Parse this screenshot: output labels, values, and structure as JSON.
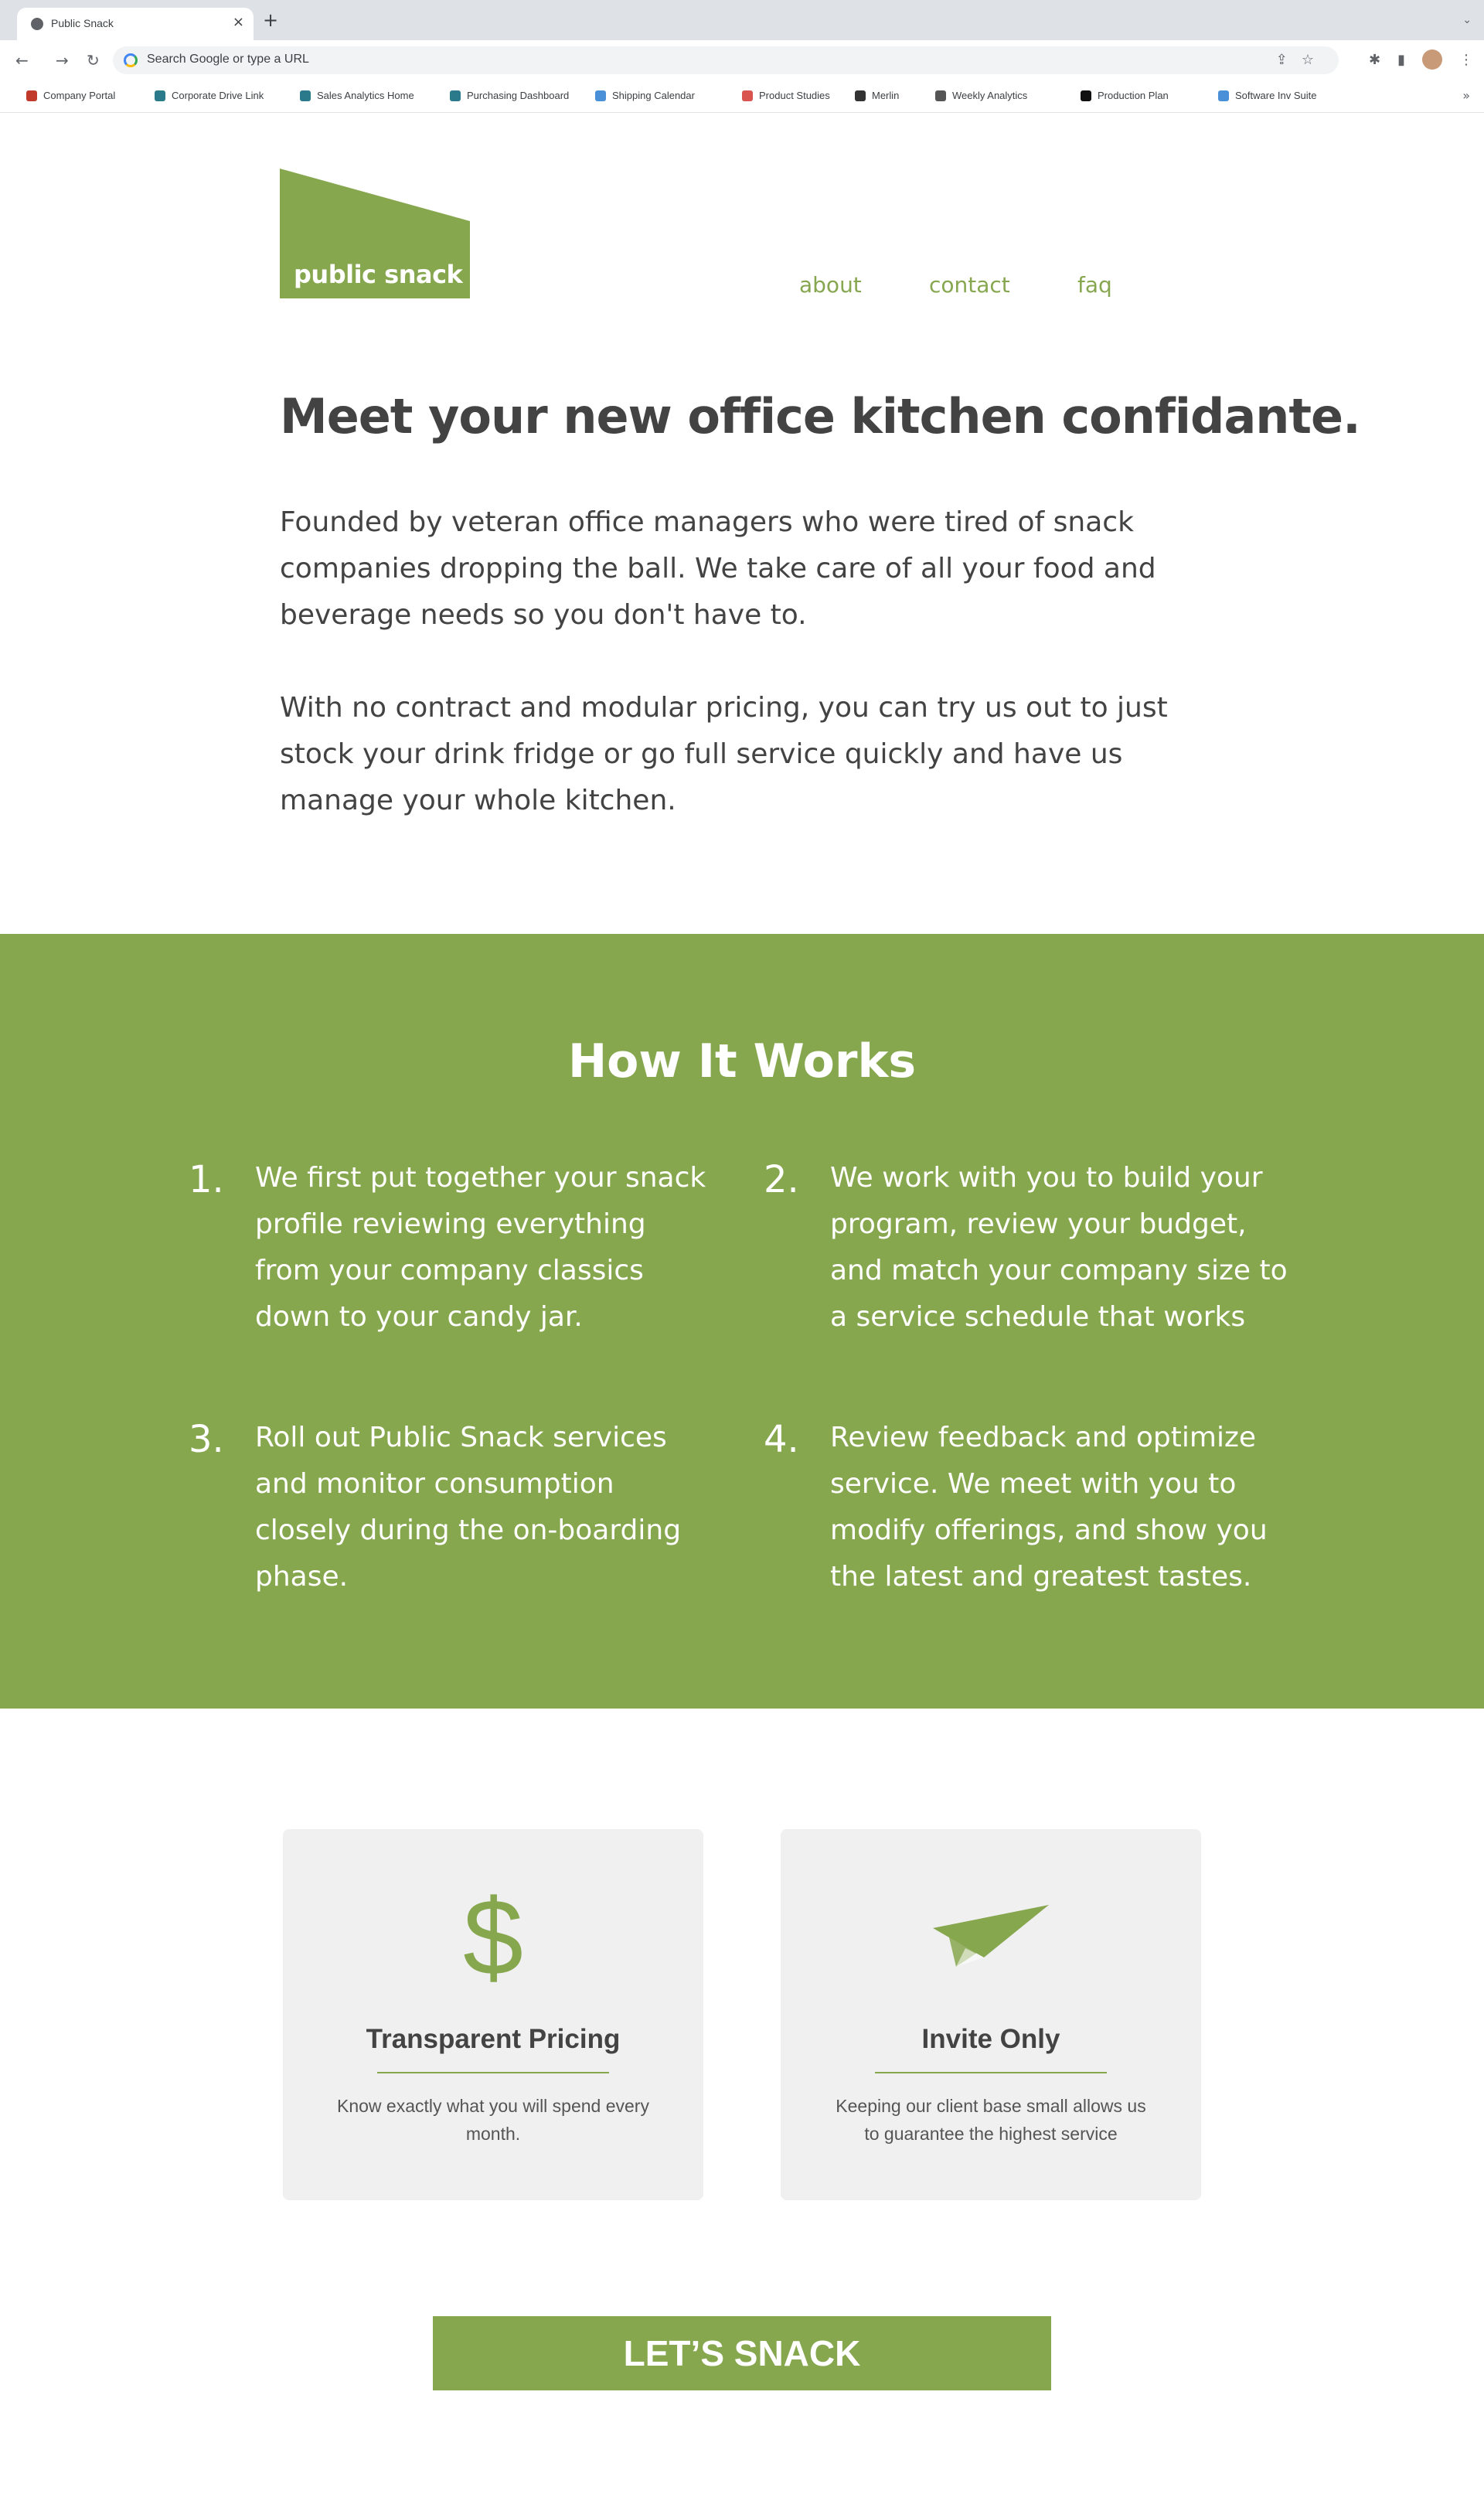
{
  "browser": {
    "tab_title": "Public Snack",
    "tab_close": "×",
    "new_tab": "+",
    "tab_search": "⌄",
    "omnibox_placeholder": "Search Google or type a URL",
    "bookmarks": [
      {
        "label": "Company Portal",
        "color": "#c0392b"
      },
      {
        "label": "Corporate Drive Link",
        "color": "#2b7a8c"
      },
      {
        "label": "Sales Analytics Home",
        "color": "#2b7a8c"
      },
      {
        "label": "Purchasing Dashboard",
        "color": "#2b7a8c"
      },
      {
        "label": "Shipping Calendar",
        "color": "#4a90d9"
      },
      {
        "label": "Product Studies",
        "color": "#d9534f"
      },
      {
        "label": "Merlin",
        "color": "#333333"
      },
      {
        "label": "Weekly Analytics",
        "color": "#555555"
      },
      {
        "label": "Production Plan",
        "color": "#111111"
      },
      {
        "label": "Software Inv Suite",
        "color": "#4a90d9"
      }
    ]
  },
  "site": {
    "logo_text": "public snack",
    "nav": {
      "about": "about",
      "contact": "contact",
      "faq": "faq"
    },
    "hero": {
      "title": "Meet your new office kitchen confidante.",
      "paragraph_1": "Founded by veteran office managers who were tired of snack companies dropping the ball. We take care of all your food and beverage needs so you don't have to.",
      "paragraph_2": "With no contract and modular pricing, you can try us out to just stock your drink fridge or go full service quickly and have us manage your whole kitchen."
    },
    "how_it_works": {
      "title": "How It Works",
      "steps": [
        {
          "num": "1.",
          "text": "We first put together your snack profile reviewing everything from your company classics down to your candy jar."
        },
        {
          "num": "2.",
          "text": "We work with you to build your program, review your budget, and match your company size to a service schedule that works"
        },
        {
          "num": "3.",
          "text": "Roll out Public Snack services and monitor consumption closely during the on-boarding phase."
        },
        {
          "num": "4.",
          "text": "Review feedback and optimize service. We meet with you to modify offerings, and show you the latest and greatest tastes."
        }
      ]
    },
    "features": [
      {
        "icon": "dollar-icon",
        "glyph": "$",
        "title": "Transparent Pricing",
        "desc": "Know exactly what you will spend every month."
      },
      {
        "icon": "paper-plane-icon",
        "title": "Invite Only",
        "desc": "Keeping our client base small allows us to guarantee the highest service"
      }
    ],
    "cta_label": "LET’S SNACK",
    "colors": {
      "brand_green": "#87a74f",
      "text_dark": "#434343",
      "card_bg": "#f0f0f0"
    }
  }
}
